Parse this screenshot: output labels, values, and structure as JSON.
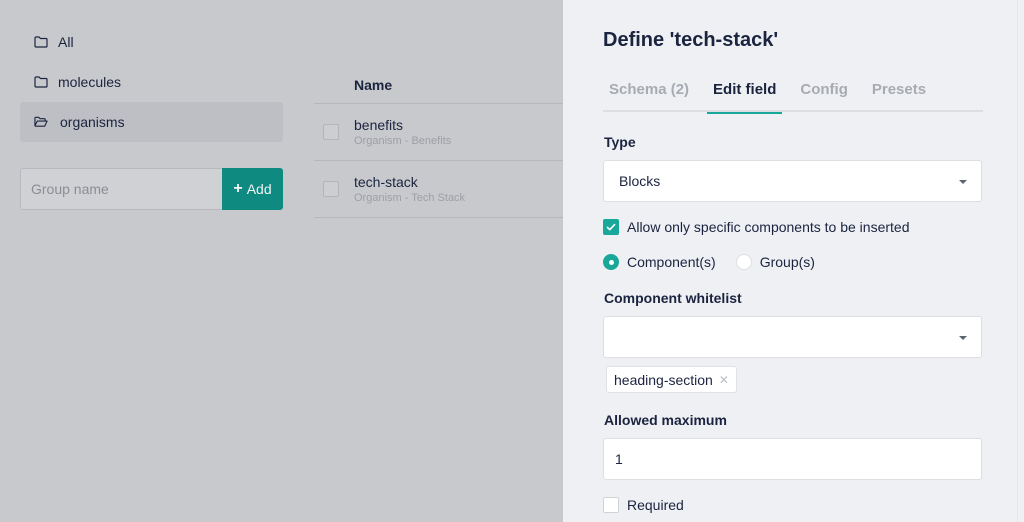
{
  "groups": {
    "items": [
      {
        "label": "All",
        "icon": "folder-icon",
        "active": false
      },
      {
        "label": "molecules",
        "icon": "folder-icon",
        "active": false
      },
      {
        "label": "organisms",
        "icon": "folder-open-icon",
        "active": true
      }
    ],
    "input_placeholder": "Group name",
    "input_value": "",
    "add_label": "Add"
  },
  "table": {
    "column_name": "Name",
    "rows": [
      {
        "name": "benefits",
        "subtitle": "Organism - Benefits",
        "checked": false
      },
      {
        "name": "tech-stack",
        "subtitle": "Organism - Tech Stack",
        "checked": false
      }
    ]
  },
  "panel": {
    "title": "Define 'tech-stack'",
    "tabs": [
      {
        "label": "Schema (2)",
        "active": false
      },
      {
        "label": "Edit field",
        "active": true
      },
      {
        "label": "Config",
        "active": false
      },
      {
        "label": "Presets",
        "active": false
      }
    ],
    "type_label": "Type",
    "type_value": "Blocks",
    "restrict_label": "Allow only specific components to be inserted",
    "restrict_checked": true,
    "radio_options": [
      {
        "label": "Component(s)",
        "selected": true
      },
      {
        "label": "Group(s)",
        "selected": false
      }
    ],
    "whitelist_label": "Component whitelist",
    "whitelist_value": "",
    "whitelist_chips": [
      "heading-section"
    ],
    "maximum_label": "Allowed maximum",
    "maximum_value": "1",
    "required_label": "Required",
    "required_checked": false
  },
  "colors": {
    "accent": "#17a89a",
    "add_button": "#0f8a80",
    "overlay": "#c8c9cd",
    "panel_bg": "#eef0f4",
    "text": "#1b243f"
  }
}
